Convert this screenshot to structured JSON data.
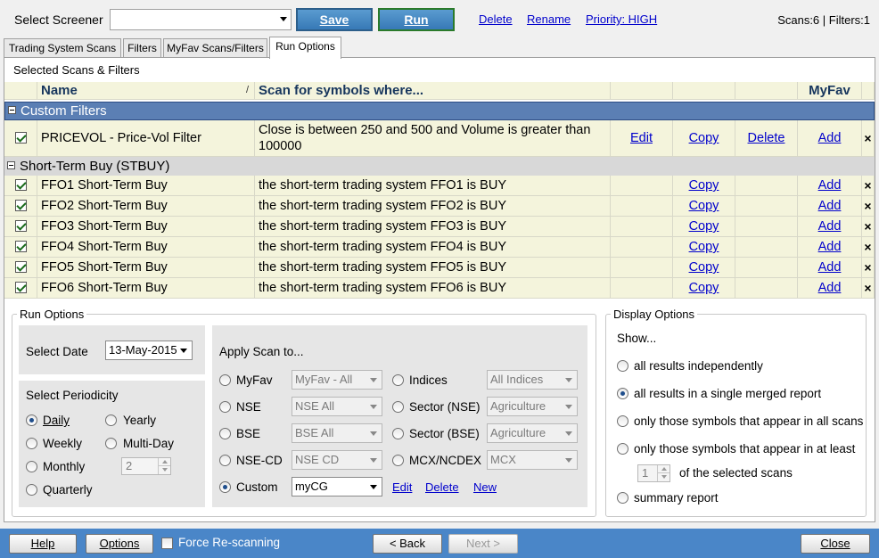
{
  "topbar": {
    "select_screener_label": "Select Screener",
    "screener_value": "",
    "save_label": "Save",
    "run_label": "Run",
    "delete_label": "Delete",
    "rename_label": "Rename",
    "priority_label": "Priority: HIGH",
    "status": "Scans:6 | Filters:1"
  },
  "tabs": [
    {
      "label": "Trading System Scans"
    },
    {
      "label": "Filters"
    },
    {
      "label": "MyFav Scans/Filters"
    },
    {
      "label": "Run Options"
    }
  ],
  "grid": {
    "caption": "Selected Scans & Filters",
    "headers": {
      "name": "Name",
      "sort_marker": "/",
      "scan": "Scan for symbols where...",
      "myfav": "MyFav"
    },
    "groups": [
      {
        "title": "Custom Filters",
        "rows": [
          {
            "name": "PRICEVOL - Price-Vol Filter",
            "condition": "Close is between 250 and 500 and Volume is greater than 100000",
            "edit": "Edit",
            "copy": "Copy",
            "delete": "Delete",
            "add": "Add",
            "remove": "×"
          }
        ]
      },
      {
        "title": "Short-Term Buy (STBUY)",
        "rows": [
          {
            "name": "FFO1 Short-Term Buy",
            "condition": "the short-term trading system FFO1 is BUY",
            "copy": "Copy",
            "add": "Add",
            "remove": "×"
          },
          {
            "name": "FFO2 Short-Term Buy",
            "condition": "the short-term trading system FFO2 is BUY",
            "copy": "Copy",
            "add": "Add",
            "remove": "×"
          },
          {
            "name": "FFO3 Short-Term Buy",
            "condition": "the short-term trading system FFO3 is BUY",
            "copy": "Copy",
            "add": "Add",
            "remove": "×"
          },
          {
            "name": "FFO4 Short-Term Buy",
            "condition": "the short-term trading system FFO4 is BUY",
            "copy": "Copy",
            "add": "Add",
            "remove": "×"
          },
          {
            "name": "FFO5 Short-Term Buy",
            "condition": "the short-term trading system FFO5 is BUY",
            "copy": "Copy",
            "add": "Add",
            "remove": "×"
          },
          {
            "name": "FFO6 Short-Term Buy",
            "condition": "the short-term trading system FFO6 is BUY",
            "copy": "Copy",
            "add": "Add",
            "remove": "×"
          }
        ]
      }
    ]
  },
  "run_options": {
    "title": "Run Options",
    "select_date_label": "Select Date",
    "date_value": "13-May-2015",
    "periodicity_label": "Select Periodicity",
    "periodicity": {
      "daily": "Daily",
      "yearly": "Yearly",
      "weekly": "Weekly",
      "multiday": "Multi-Day",
      "monthly": "Monthly",
      "quarterly": "Quarterly",
      "multiday_value": "2"
    },
    "apply_label": "Apply Scan to...",
    "apply": {
      "myfav": "MyFav",
      "myfav_value": "MyFav - All",
      "nse": "NSE",
      "nse_value": "NSE All",
      "bse": "BSE",
      "bse_value": "BSE All",
      "nsecd": "NSE-CD",
      "nsecd_value": "NSE CD",
      "custom": "Custom",
      "custom_value": "myCG",
      "indices": "Indices",
      "indices_value": "All Indices",
      "sector_nse": "Sector (NSE)",
      "sector_nse_value": "Agriculture",
      "sector_bse": "Sector (BSE)",
      "sector_bse_value": "Agriculture",
      "mcx": "MCX/NCDEX",
      "mcx_value": "MCX",
      "edit": "Edit",
      "delete": "Delete",
      "new": "New"
    }
  },
  "display_options": {
    "title": "Display Options",
    "show_label": "Show...",
    "opt_independent": "all results independently",
    "opt_merged": "all results in a single merged report",
    "opt_all_scans": "only those symbols that appear in all scans",
    "opt_at_least": "only those symbols that appear in at least",
    "at_least_value": "1",
    "at_least_suffix": "of the selected scans",
    "opt_summary": "summary report"
  },
  "footer": {
    "help": "Help",
    "options": "Options",
    "force_rescan": "Force Re-scanning",
    "back": "< Back",
    "next": "Next >",
    "close": "Close"
  }
}
